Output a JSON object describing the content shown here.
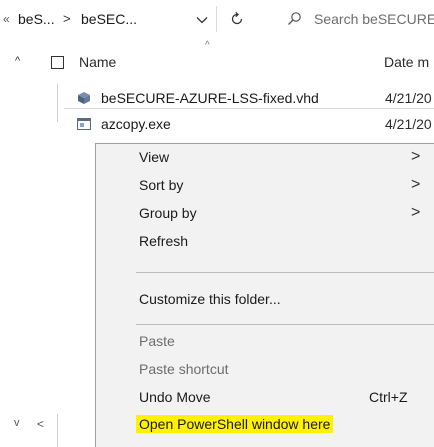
{
  "address_bar": {
    "overflow": "«",
    "crumbs": [
      "beS...",
      "beSEC..."
    ],
    "separator": ">",
    "dropdown_icon": "chevron-down-icon",
    "refresh_icon": "refresh-icon",
    "search_placeholder": "Search beSECURE"
  },
  "columns": {
    "collapse": "^",
    "sort_caret": "^",
    "name": "Name",
    "date": "Date m"
  },
  "files": [
    {
      "name": "beSECURE-AZURE-LSS-fixed.vhd",
      "date": "4/21/20",
      "icon": "vhd-disk-icon"
    },
    {
      "name": "azcopy.exe",
      "date": "4/21/20",
      "icon": "exe-application-icon"
    }
  ],
  "nav_pane": {
    "down": "v",
    "left": "<"
  },
  "context_menu": {
    "items": [
      {
        "label": "View",
        "submenu": ">"
      },
      {
        "label": "Sort by",
        "submenu": ">"
      },
      {
        "label": "Group by",
        "submenu": ">"
      },
      {
        "label": "Refresh"
      },
      {
        "label": "Customize this folder..."
      },
      {
        "label": "Paste",
        "disabled": true
      },
      {
        "label": "Paste shortcut",
        "disabled": true
      },
      {
        "label": "Undo Move",
        "shortcut": "Ctrl+Z"
      },
      {
        "label": "Open PowerShell window here",
        "highlighted": true
      }
    ],
    "highlight_color": "#fff200"
  }
}
